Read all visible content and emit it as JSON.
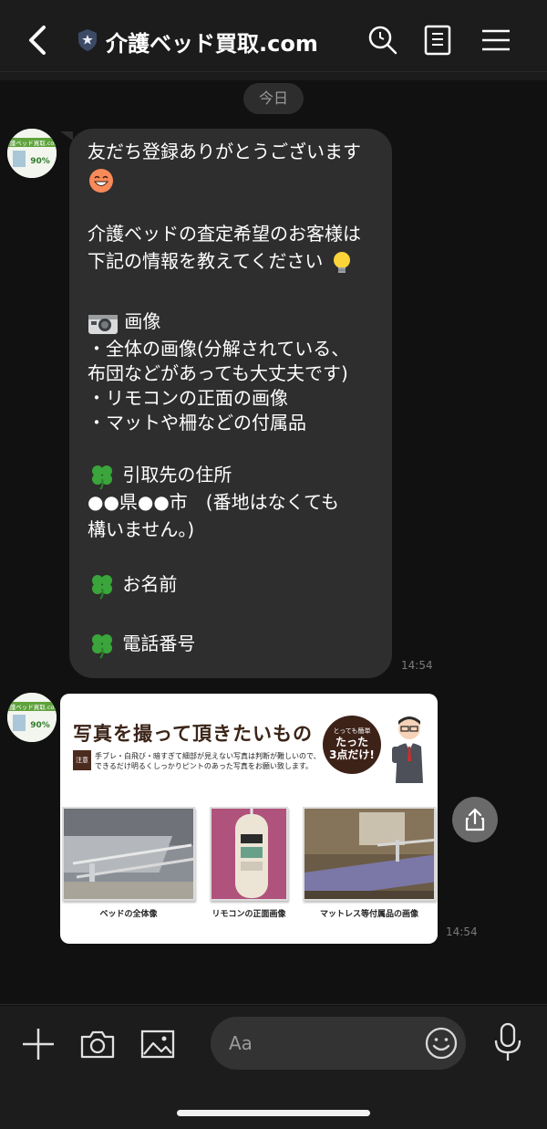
{
  "header": {
    "title": "介護ベッド買取.com",
    "icons": [
      "back-arrow-icon",
      "verified-shield-icon",
      "search-icon",
      "notes-icon",
      "menu-icon"
    ]
  },
  "date_divider": "今日",
  "avatar": {
    "brand_text": "介護ベッド買取.com",
    "percent_text": "90%"
  },
  "messages": [
    {
      "type": "text",
      "lines": [
        "友だち登録ありがとうございます",
        "",
        "",
        "介護ベッドの査定希望のお客様は",
        "下記の情報を教えてください",
        "",
        "画像",
        "・全体の画像(分解されている、",
        "布団などがあっても大丈夫です)",
        "・リモコンの正面の画像",
        "・マットや柵などの付属品",
        "",
        "引取先の住所",
        "●●県●●市　(番地はなくても",
        "構いません。)",
        "",
        "お名前",
        "",
        "電話番号"
      ],
      "emojis": [
        "grinning-face-icon",
        "light-bulb-icon",
        "camera-icon",
        "four-leaf-clover-icon"
      ],
      "time": "14:54"
    },
    {
      "type": "image",
      "title": "写真を撮って頂きたいもの",
      "notice_tag": "注意",
      "notice_line1": "手ブレ・白飛び・暗すぎて細部が見えない写真は判断が難しいので、",
      "notice_line2": "できるだけ明るくしっかりピントのあった写真をお願い致します。",
      "badge_top": "とっても簡単",
      "badge_line1": "たった",
      "badge_line2": "3点だけ!",
      "photos": [
        {
          "label": "ベッドの全体像"
        },
        {
          "label": "リモコンの正面画像"
        },
        {
          "label": "マットレス等付属品の画像"
        }
      ],
      "time": "14:54"
    }
  ],
  "input": {
    "placeholder": "Aa"
  },
  "colors": {
    "background": "#111111",
    "bubble": "#2e2e2e",
    "header": "#1c1c1c",
    "clover": "#3aa53a"
  }
}
